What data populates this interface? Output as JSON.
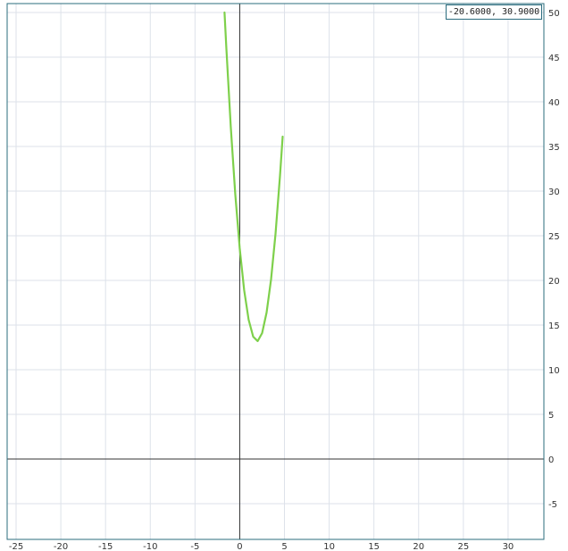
{
  "readout": "-20.6000, 30.9000",
  "colors": {
    "curve": "#7ed04b",
    "grid": "#dde2ea",
    "axis": "#333333",
    "frame": "#2b6c7e"
  },
  "chart_data": {
    "type": "line",
    "title": "",
    "xlabel": "",
    "ylabel": "",
    "xlim": [
      -26,
      34
    ],
    "ylim": [
      -9,
      51
    ],
    "grid": true,
    "x_ticks": [
      -25,
      -20,
      -15,
      -10,
      -5,
      0,
      5,
      10,
      15,
      20,
      25,
      30
    ],
    "x_tick_labels": [
      "-25",
      "-20",
      "-15",
      "-10",
      "-5",
      "0",
      "5",
      "10",
      "15",
      "20",
      "25",
      "30"
    ],
    "y_ticks": [
      -5,
      0,
      5,
      10,
      15,
      20,
      25,
      30,
      35,
      40,
      45,
      50
    ],
    "y_tick_labels": [
      "-5",
      "0",
      "5",
      "10",
      "15",
      "20",
      "25",
      "30",
      "35",
      "40",
      "45",
      "50"
    ],
    "series": [
      {
        "color": "#7ed04b",
        "x": [
          -1.7,
          -1.5,
          -1.0,
          -0.5,
          0.0,
          0.5,
          1.0,
          1.5,
          2.0,
          2.5,
          3.0,
          3.5,
          4.0,
          4.5,
          4.8
        ],
        "y": [
          50.0,
          46.1,
          37.2,
          29.7,
          23.6,
          18.9,
          15.6,
          13.7,
          13.2,
          14.1,
          16.4,
          20.1,
          25.2,
          31.7,
          36.1
        ]
      }
    ]
  }
}
